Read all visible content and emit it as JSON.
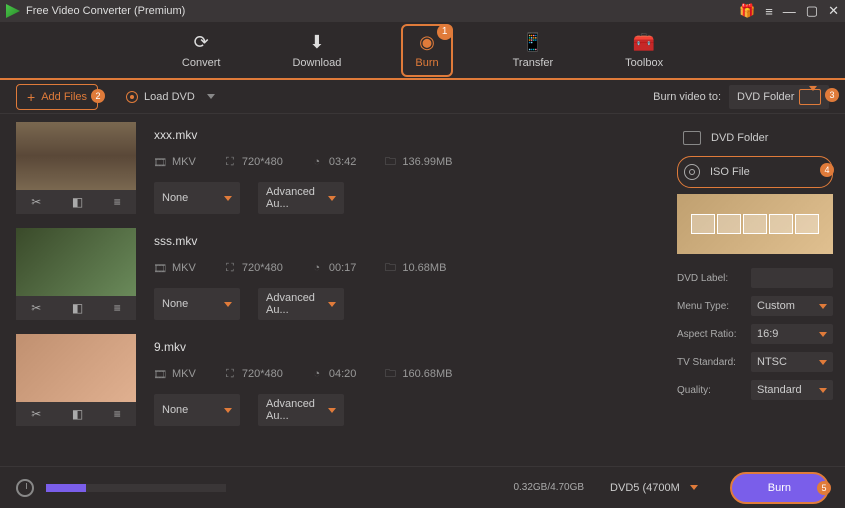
{
  "app": {
    "title": "Free Video Converter (Premium)"
  },
  "nav": {
    "items": [
      {
        "label": "Convert"
      },
      {
        "label": "Download"
      },
      {
        "label": "Burn",
        "badge": "1"
      },
      {
        "label": "Transfer"
      },
      {
        "label": "Toolbox"
      }
    ]
  },
  "toolbar": {
    "add_files": "Add Files",
    "add_files_badge": "2",
    "load_dvd": "Load DVD",
    "burn_to_label": "Burn video to:",
    "burn_to_value": "DVD Folder",
    "burn_to_badge": "3"
  },
  "files": [
    {
      "name": "xxx.mkv",
      "format": "MKV",
      "resolution": "720*480",
      "duration": "03:42",
      "size": "136.99MB",
      "subtitle": "None",
      "audio": "Advanced Au..."
    },
    {
      "name": "sss.mkv",
      "format": "MKV",
      "resolution": "720*480",
      "duration": "00:17",
      "size": "10.68MB",
      "subtitle": "None",
      "audio": "Advanced Au..."
    },
    {
      "name": "9.mkv",
      "format": "MKV",
      "resolution": "720*480",
      "duration": "04:20",
      "size": "160.68MB",
      "subtitle": "None",
      "audio": "Advanced Au..."
    }
  ],
  "sidebar": {
    "options": [
      {
        "label": "DVD Folder"
      },
      {
        "label": "ISO File",
        "badge": "4"
      }
    ],
    "fields": {
      "dvd_label_label": "DVD Label:",
      "dvd_label_value": "",
      "menu_type_label": "Menu Type:",
      "menu_type_value": "Custom",
      "aspect_label": "Aspect Ratio:",
      "aspect_value": "16:9",
      "tv_label": "TV Standard:",
      "tv_value": "NTSC",
      "quality_label": "Quality:",
      "quality_value": "Standard"
    }
  },
  "bottom": {
    "size": "0.32GB/4.70GB",
    "disc": "DVD5 (4700M",
    "burn": "Burn",
    "burn_badge": "5"
  }
}
